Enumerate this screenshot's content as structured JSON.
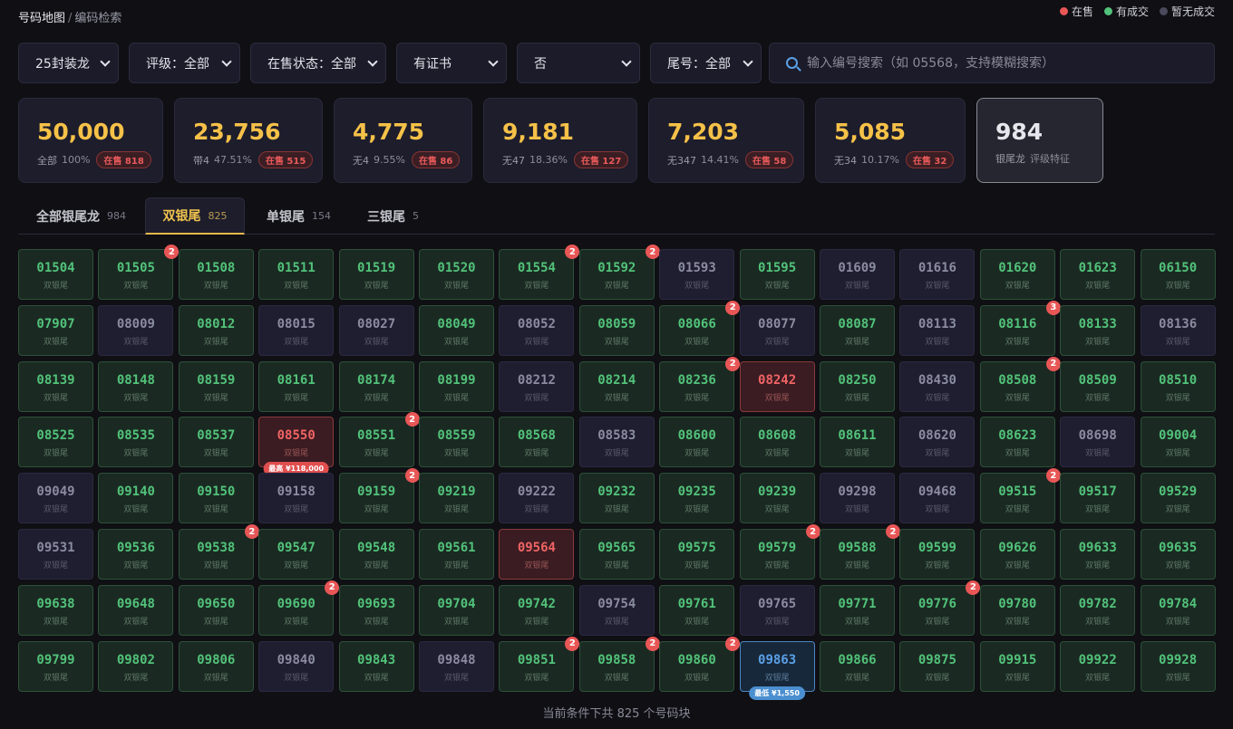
{
  "breadcrumb": {
    "main": "号码地图",
    "sep": "/",
    "sub": "编码检索"
  },
  "legend": [
    {
      "label": "在售",
      "color": "#e85656"
    },
    {
      "label": "有成交",
      "color": "#52c27a"
    },
    {
      "label": "暂无成交",
      "color": "#4a4a5c"
    }
  ],
  "filters": [
    {
      "name": "filter-pack",
      "value": "25封装龙"
    },
    {
      "name": "filter-rating",
      "value": "评级：全部"
    },
    {
      "name": "filter-sale-status",
      "value": "在售状态：全部"
    },
    {
      "name": "filter-certificate",
      "value": "有证书"
    },
    {
      "name": "filter-flag",
      "value": "否"
    },
    {
      "name": "filter-tail",
      "value": "尾号：全部"
    }
  ],
  "search": {
    "placeholder": "输入编号搜索（如 05568，支持模糊搜索）",
    "value": ""
  },
  "stats": [
    {
      "value": "50,000",
      "label": "全部",
      "pct": "100%",
      "badge": "在售 818"
    },
    {
      "value": "23,756",
      "label": "带4",
      "pct": "47.51%",
      "badge": "在售 515"
    },
    {
      "value": "4,775",
      "label": "无4",
      "pct": "9.55%",
      "badge": "在售 86"
    },
    {
      "value": "9,181",
      "label": "无47",
      "pct": "18.36%",
      "badge": "在售 127"
    },
    {
      "value": "7,203",
      "label": "无347",
      "pct": "14.41%",
      "badge": "在售 58"
    },
    {
      "value": "5,085",
      "label": "无34",
      "pct": "10.17%",
      "badge": "在售 32"
    },
    {
      "value": "984",
      "label": "银尾龙",
      "pct": "评级特征",
      "badge": ""
    }
  ],
  "tabs": [
    {
      "label": "全部银尾龙",
      "count": "984"
    },
    {
      "label": "双银尾",
      "count": "825"
    },
    {
      "label": "单银尾",
      "count": "154"
    },
    {
      "label": "三银尾",
      "count": "5"
    }
  ],
  "cell_tag": "双银尾",
  "cells": [
    {
      "n": "01504",
      "s": "sale"
    },
    {
      "n": "01505",
      "s": "sale",
      "b": "2"
    },
    {
      "n": "01508",
      "s": "sale"
    },
    {
      "n": "01511",
      "s": "sale"
    },
    {
      "n": "01519",
      "s": "sale"
    },
    {
      "n": "01520",
      "s": "sale"
    },
    {
      "n": "01554",
      "s": "sale",
      "b": "2"
    },
    {
      "n": "01592",
      "s": "sale",
      "b": "2"
    },
    {
      "n": "01593",
      "s": "none"
    },
    {
      "n": "01595",
      "s": "sale"
    },
    {
      "n": "01609",
      "s": "none"
    },
    {
      "n": "01616",
      "s": "none"
    },
    {
      "n": "01620",
      "s": "sale"
    },
    {
      "n": "01623",
      "s": "sale"
    },
    {
      "n": "06150",
      "s": "sale"
    },
    {
      "n": "07907",
      "s": "sale"
    },
    {
      "n": "08009",
      "s": "none"
    },
    {
      "n": "08012",
      "s": "sale"
    },
    {
      "n": "08015",
      "s": "none"
    },
    {
      "n": "08027",
      "s": "none"
    },
    {
      "n": "08049",
      "s": "sale"
    },
    {
      "n": "08052",
      "s": "none"
    },
    {
      "n": "08059",
      "s": "sale"
    },
    {
      "n": "08066",
      "s": "sale",
      "b": "2"
    },
    {
      "n": "08077",
      "s": "none"
    },
    {
      "n": "08087",
      "s": "sale"
    },
    {
      "n": "08113",
      "s": "none"
    },
    {
      "n": "08116",
      "s": "sale",
      "b": "3"
    },
    {
      "n": "08133",
      "s": "sale"
    },
    {
      "n": "08136",
      "s": "none"
    },
    {
      "n": "08139",
      "s": "sale"
    },
    {
      "n": "08148",
      "s": "sale"
    },
    {
      "n": "08159",
      "s": "sale"
    },
    {
      "n": "08161",
      "s": "sale"
    },
    {
      "n": "08174",
      "s": "sale"
    },
    {
      "n": "08199",
      "s": "sale"
    },
    {
      "n": "08212",
      "s": "none"
    },
    {
      "n": "08214",
      "s": "sale"
    },
    {
      "n": "08236",
      "s": "sale",
      "b": "2"
    },
    {
      "n": "08242",
      "s": "hot"
    },
    {
      "n": "08250",
      "s": "sale"
    },
    {
      "n": "08430",
      "s": "none"
    },
    {
      "n": "08508",
      "s": "sale",
      "b": "2"
    },
    {
      "n": "08509",
      "s": "sale"
    },
    {
      "n": "08510",
      "s": "sale"
    },
    {
      "n": "08525",
      "s": "sale"
    },
    {
      "n": "08535",
      "s": "sale"
    },
    {
      "n": "08537",
      "s": "sale"
    },
    {
      "n": "08550",
      "s": "hot",
      "p": "最高 ¥118,000",
      "pt": "max"
    },
    {
      "n": "08551",
      "s": "sale",
      "b": "2"
    },
    {
      "n": "08559",
      "s": "sale"
    },
    {
      "n": "08568",
      "s": "sale"
    },
    {
      "n": "08583",
      "s": "none"
    },
    {
      "n": "08600",
      "s": "sale"
    },
    {
      "n": "08608",
      "s": "sale"
    },
    {
      "n": "08611",
      "s": "sale"
    },
    {
      "n": "08620",
      "s": "none"
    },
    {
      "n": "08623",
      "s": "sale"
    },
    {
      "n": "08698",
      "s": "none"
    },
    {
      "n": "09004",
      "s": "sale"
    },
    {
      "n": "09049",
      "s": "none"
    },
    {
      "n": "09140",
      "s": "sale"
    },
    {
      "n": "09150",
      "s": "sale"
    },
    {
      "n": "09158",
      "s": "none"
    },
    {
      "n": "09159",
      "s": "sale",
      "b": "2"
    },
    {
      "n": "09219",
      "s": "sale"
    },
    {
      "n": "09222",
      "s": "none"
    },
    {
      "n": "09232",
      "s": "sale"
    },
    {
      "n": "09235",
      "s": "sale"
    },
    {
      "n": "09239",
      "s": "sale"
    },
    {
      "n": "09298",
      "s": "none"
    },
    {
      "n": "09468",
      "s": "none"
    },
    {
      "n": "09515",
      "s": "sale",
      "b": "2"
    },
    {
      "n": "09517",
      "s": "sale"
    },
    {
      "n": "09529",
      "s": "sale"
    },
    {
      "n": "09531",
      "s": "none"
    },
    {
      "n": "09536",
      "s": "sale"
    },
    {
      "n": "09538",
      "s": "sale",
      "b": "2"
    },
    {
      "n": "09547",
      "s": "sale"
    },
    {
      "n": "09548",
      "s": "sale"
    },
    {
      "n": "09561",
      "s": "sale"
    },
    {
      "n": "09564",
      "s": "hot"
    },
    {
      "n": "09565",
      "s": "sale"
    },
    {
      "n": "09575",
      "s": "sale"
    },
    {
      "n": "09579",
      "s": "sale",
      "b": "2"
    },
    {
      "n": "09588",
      "s": "sale",
      "b": "2"
    },
    {
      "n": "09599",
      "s": "sale"
    },
    {
      "n": "09626",
      "s": "sale"
    },
    {
      "n": "09633",
      "s": "sale"
    },
    {
      "n": "09635",
      "s": "sale"
    },
    {
      "n": "09638",
      "s": "sale"
    },
    {
      "n": "09648",
      "s": "sale"
    },
    {
      "n": "09650",
      "s": "sale"
    },
    {
      "n": "09690",
      "s": "sale",
      "b": "2"
    },
    {
      "n": "09693",
      "s": "sale"
    },
    {
      "n": "09704",
      "s": "sale"
    },
    {
      "n": "09742",
      "s": "sale"
    },
    {
      "n": "09754",
      "s": "none"
    },
    {
      "n": "09761",
      "s": "sale"
    },
    {
      "n": "09765",
      "s": "none"
    },
    {
      "n": "09771",
      "s": "sale"
    },
    {
      "n": "09776",
      "s": "sale",
      "b": "2"
    },
    {
      "n": "09780",
      "s": "sale"
    },
    {
      "n": "09782",
      "s": "sale"
    },
    {
      "n": "09784",
      "s": "sale"
    },
    {
      "n": "09799",
      "s": "sale"
    },
    {
      "n": "09802",
      "s": "sale"
    },
    {
      "n": "09806",
      "s": "sale"
    },
    {
      "n": "09840",
      "s": "none"
    },
    {
      "n": "09843",
      "s": "sale"
    },
    {
      "n": "09848",
      "s": "none"
    },
    {
      "n": "09851",
      "s": "sale",
      "b": "2"
    },
    {
      "n": "09858",
      "s": "sale",
      "b": "2"
    },
    {
      "n": "09860",
      "s": "sale",
      "b": "2"
    },
    {
      "n": "09863",
      "s": "low",
      "p": "最低 ¥1,550",
      "pt": "min"
    },
    {
      "n": "09866",
      "s": "sale"
    },
    {
      "n": "09875",
      "s": "sale"
    },
    {
      "n": "09915",
      "s": "sale"
    },
    {
      "n": "09922",
      "s": "sale"
    },
    {
      "n": "09928",
      "s": "sale"
    }
  ],
  "footer": "当前条件下共 825 个号码块"
}
